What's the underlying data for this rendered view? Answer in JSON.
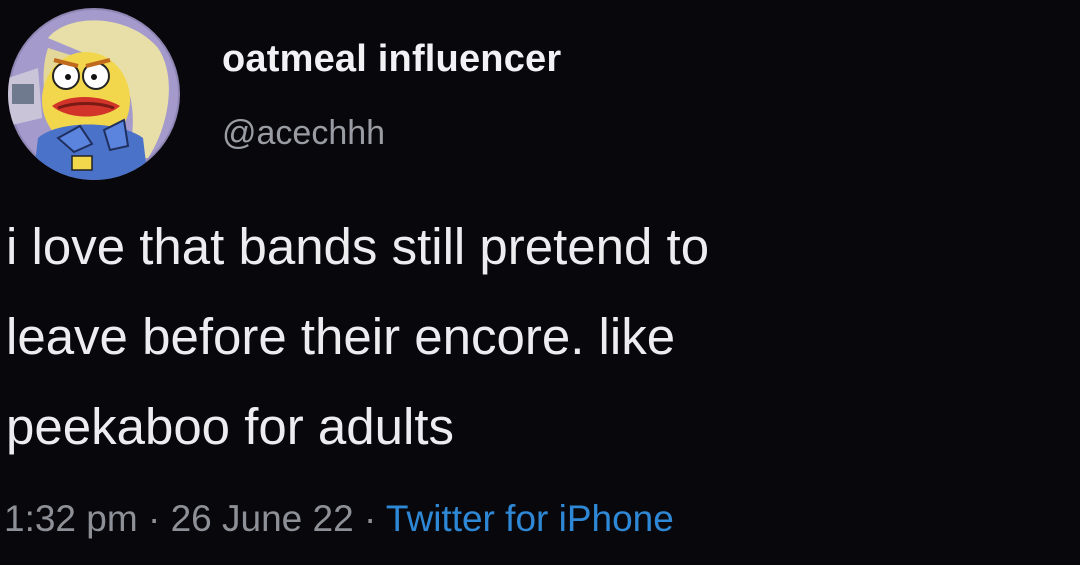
{
  "user": {
    "display_name": "oatmeal influencer",
    "handle": "@acechhh",
    "avatar_icon": "cartoon-avatar-icon"
  },
  "tweet": {
    "lines": [
      "i love that bands still pretend to",
      "leave before their encore. like",
      "peekaboo for adults"
    ]
  },
  "meta": {
    "time": "1:32 pm",
    "separator": " · ",
    "date": "26 June 22",
    "source": "Twitter for iPhone"
  },
  "colors": {
    "background": "#08080c",
    "text": "#ededf0",
    "muted": "#8e9097",
    "link": "#2e88d6"
  }
}
